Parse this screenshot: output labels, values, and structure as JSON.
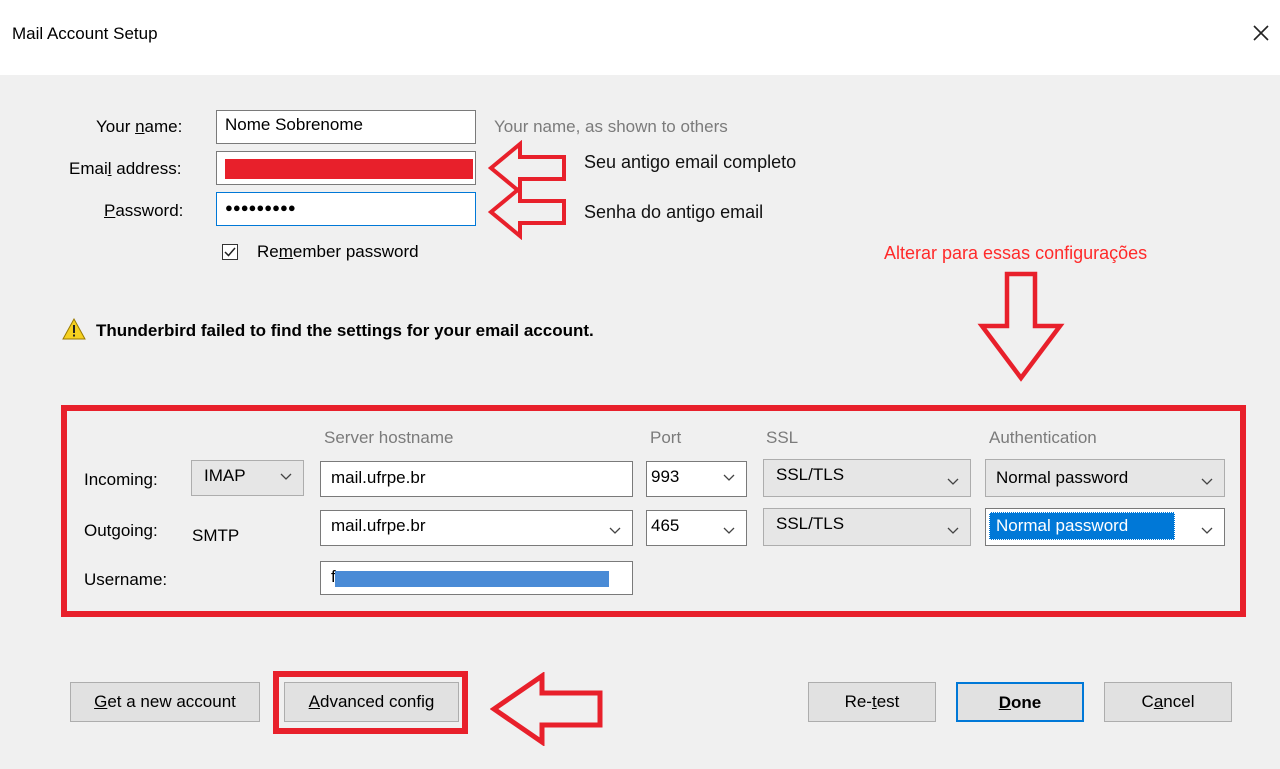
{
  "window": {
    "title": "Mail Account Setup"
  },
  "form": {
    "name_label_pre": "Your ",
    "name_label_ul": "n",
    "name_label_post": "ame:",
    "name_value": "Nome Sobrenome",
    "name_hint": "Your name, as shown to others",
    "email_label_pre": "Emai",
    "email_label_ul": "l",
    "email_label_post": " address:",
    "password_label_ul": "P",
    "password_label_post": "assword:",
    "password_value": "●●●●●●●●●",
    "remember_pre": "Re",
    "remember_ul": "m",
    "remember_post": "ember password",
    "remember_checked": true
  },
  "annotations": {
    "email_note": "Seu antigo email completo",
    "password_note": "Senha do antigo email",
    "settings_note": "Alterar para essas configurações",
    "accent": "#e8202b"
  },
  "warning": {
    "text": "Thunderbird failed to find the settings for your email account."
  },
  "servers": {
    "headers": {
      "hostname": "Server hostname",
      "port": "Port",
      "ssl": "SSL",
      "auth": "Authentication"
    },
    "incoming": {
      "label": "Incoming:",
      "protocol": "IMAP",
      "hostname": "mail.ufrpe.br",
      "port": "993",
      "ssl": "SSL/TLS",
      "auth": "Normal password"
    },
    "outgoing": {
      "label": "Outgoing:",
      "protocol": "SMTP",
      "hostname": "mail.ufrpe.br",
      "port": "465",
      "ssl": "SSL/TLS",
      "auth": "Normal password"
    },
    "username": {
      "label": "Username:",
      "value_initial": "f"
    }
  },
  "buttons": {
    "new_account_pre": "",
    "new_account_ul": "G",
    "new_account_post": "et a new account",
    "advanced_ul": "A",
    "advanced_post": "dvanced config",
    "retest_pre": "Re-",
    "retest_ul": "t",
    "retest_post": "est",
    "done_ul": "D",
    "done_post": "one",
    "cancel_pre": "C",
    "cancel_ul": "a",
    "cancel_post": "ncel"
  }
}
